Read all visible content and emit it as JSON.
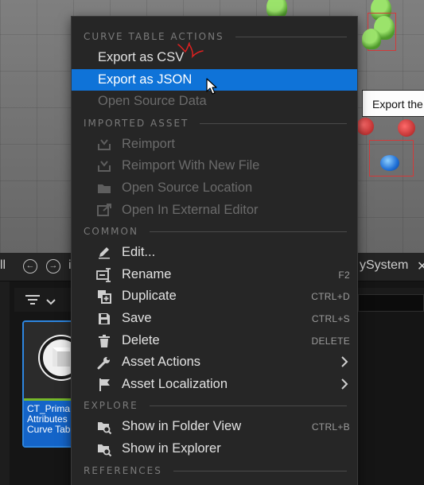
{
  "tooltip": {
    "text": "Export the"
  },
  "content_browser": {
    "toolbar_left_fragment": "ll",
    "toolbar_mid_fragment": "i",
    "toolbar_right_fragment": "ySystem",
    "close_glyph": "✕",
    "asset": {
      "name_line1": "CT_Prima",
      "name_line2": "Attributes",
      "type": "Curve Tab",
      "accent_color": "#1464c8",
      "type_color": "#76b82a"
    }
  },
  "menu": {
    "sections": [
      {
        "label": "CURVE TABLE ACTIONS",
        "items": [
          {
            "label": "Export as CSV",
            "state": "normal",
            "icon": ""
          },
          {
            "label": "Export as JSON",
            "state": "selected",
            "icon": ""
          },
          {
            "label": "Open Source Data",
            "state": "disabled",
            "icon": ""
          }
        ]
      },
      {
        "label": "IMPORTED ASSET",
        "items": [
          {
            "label": "Reimport",
            "state": "disabled",
            "icon": "reimport-icon"
          },
          {
            "label": "Reimport With New File",
            "state": "disabled",
            "icon": "reimport-icon"
          },
          {
            "label": "Open Source Location",
            "state": "disabled",
            "icon": "folder-icon"
          },
          {
            "label": "Open In External Editor",
            "state": "disabled",
            "icon": "external-editor-icon"
          }
        ]
      },
      {
        "label": "COMMON",
        "items": [
          {
            "label": "Edit...",
            "state": "normal",
            "icon": "pencil-icon"
          },
          {
            "label": "Rename",
            "state": "normal",
            "icon": "rename-icon",
            "shortcut": "F2"
          },
          {
            "label": "Duplicate",
            "state": "normal",
            "icon": "duplicate-icon",
            "shortcut": "CTRL+D"
          },
          {
            "label": "Save",
            "state": "normal",
            "icon": "save-icon",
            "shortcut": "CTRL+S"
          },
          {
            "label": "Delete",
            "state": "normal",
            "icon": "trash-icon",
            "shortcut": "DELETE"
          },
          {
            "label": "Asset Actions",
            "state": "normal",
            "icon": "wrench-icon",
            "submenu": true
          },
          {
            "label": "Asset Localization",
            "state": "normal",
            "icon": "flag-icon",
            "submenu": true
          }
        ]
      },
      {
        "label": "EXPLORE",
        "items": [
          {
            "label": "Show in Folder View",
            "state": "normal",
            "icon": "folder-search-icon",
            "shortcut": "CTRL+B"
          },
          {
            "label": "Show in Explorer",
            "state": "normal",
            "icon": "folder-search-icon"
          }
        ]
      },
      {
        "label": "REFERENCES",
        "items": []
      }
    ]
  },
  "colors": {
    "menu_bg": "#262626",
    "selected_bg": "#0f73d8",
    "annotation_red": "#e02020"
  }
}
